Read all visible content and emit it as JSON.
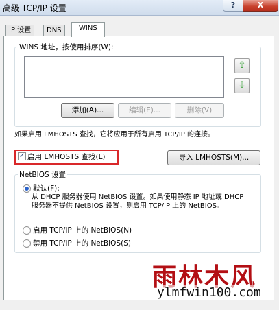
{
  "window": {
    "title": "高级 TCP/IP 设置",
    "help_glyph": "?",
    "close_glyph": "X"
  },
  "tabs": [
    {
      "label": "IP 设置"
    },
    {
      "label": "DNS"
    },
    {
      "label": "WINS",
      "active": true
    }
  ],
  "wins": {
    "group_label": "WINS 地址，按使用排序(W):",
    "addresses": [],
    "move_up_glyph": "⇧",
    "move_down_glyph": "⇩",
    "add_label": "添加(A)...",
    "edit_label": "编辑(E)...",
    "remove_label": "删除(V)"
  },
  "lmhosts": {
    "note": "如果启用 LMHOSTS 查找，它将应用于所有启用 TCP/IP 的连接。",
    "enable_label": "启用 LMHOSTS 查找(L)",
    "enable_checked": true,
    "check_glyph": "✓",
    "import_label": "导入 LMHOSTS(M)..."
  },
  "netbios": {
    "group_label": "NetBIOS 设置",
    "options": [
      {
        "label": "默认(F):",
        "selected": true
      },
      {
        "label": "启用 TCP/IP 上的 NetBIOS(N)",
        "selected": false
      },
      {
        "label": "禁用 TCP/IP 上的 NetBIOS(S)",
        "selected": false
      }
    ],
    "default_desc": "从 DHCP 服务器使用 NetBIOS 设置。如果使用静态 IP 地址或 DHCP 服务器不提供 NetBIOS 设置，则启用 TCP/IP 上的 NetBIOS。"
  },
  "watermark": {
    "text_cn": "雨林木风",
    "url": "ylmfwin100.com",
    "color": "#b30f14"
  },
  "colors": {
    "highlight_border": "#d9282a",
    "arrow_green": "#3aa23a"
  }
}
